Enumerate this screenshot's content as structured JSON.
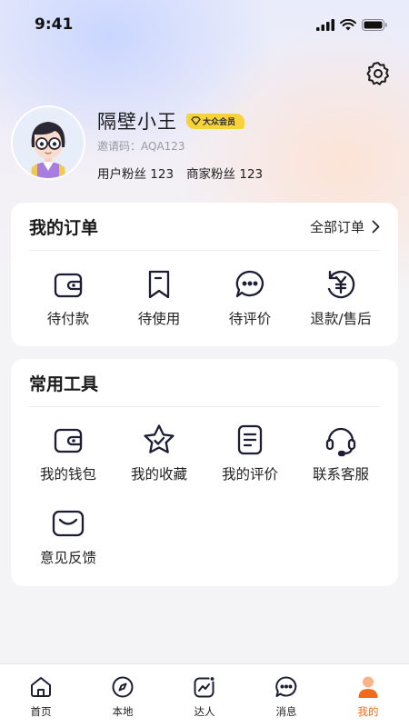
{
  "status_bar": {
    "time": "9:41"
  },
  "profile": {
    "name": "隔壁小王",
    "badge": "大众会员",
    "invite": "邀请码：AQA123",
    "user_fans": "用户粉丝 123",
    "merchant_fans": "商家粉丝 123"
  },
  "orders": {
    "title": "我的订单",
    "all_label": "全部订单",
    "items": [
      {
        "label": "待付款",
        "icon": "wallet-icon"
      },
      {
        "label": "待使用",
        "icon": "bookmark-icon"
      },
      {
        "label": "待评价",
        "icon": "chat-bubble-icon"
      },
      {
        "label": "退款/售后",
        "icon": "refund-yen-icon"
      }
    ]
  },
  "tools": {
    "title": "常用工具",
    "items": [
      {
        "label": "我的钱包",
        "icon": "wallet-icon"
      },
      {
        "label": "我的收藏",
        "icon": "star-icon"
      },
      {
        "label": "我的评价",
        "icon": "document-icon"
      },
      {
        "label": "联系客服",
        "icon": "headset-icon"
      },
      {
        "label": "意见反馈",
        "icon": "envelope-icon"
      }
    ]
  },
  "tab_bar": {
    "tabs": [
      {
        "label": "首页",
        "icon": "home-icon"
      },
      {
        "label": "本地",
        "icon": "compass-icon"
      },
      {
        "label": "达人",
        "icon": "trend-icon"
      },
      {
        "label": "消息",
        "icon": "message-icon"
      },
      {
        "label": "我的",
        "icon": "person-icon",
        "active": true
      }
    ]
  },
  "colors": {
    "accent": "#f26b1d",
    "badge": "#f6d23b",
    "icon_stroke": "#1d1d35"
  }
}
